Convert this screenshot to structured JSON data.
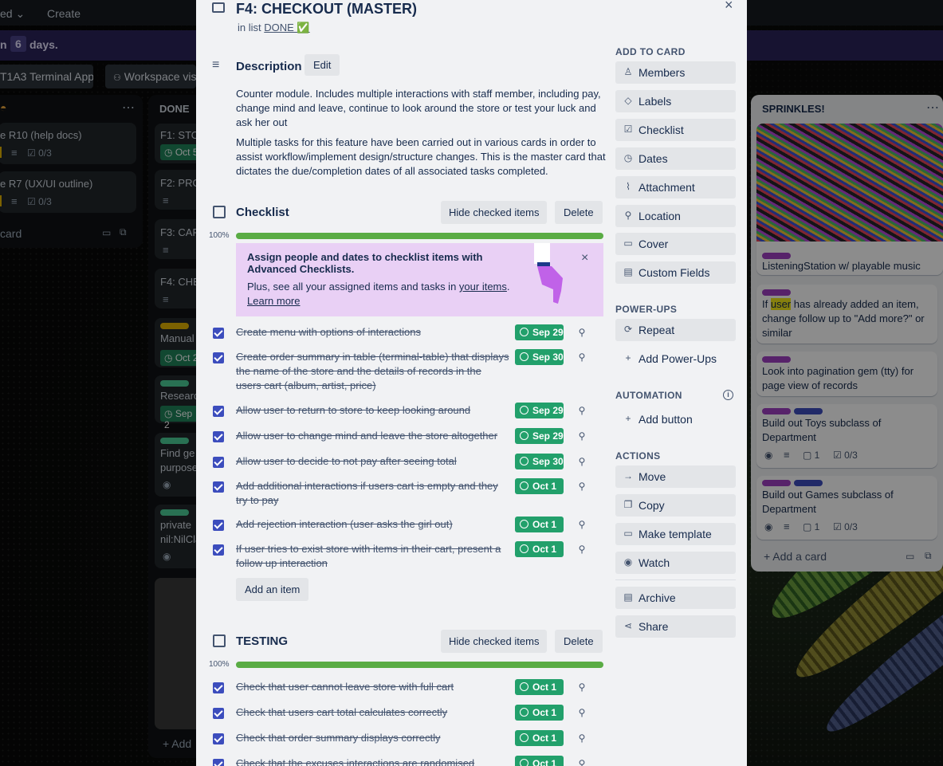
{
  "topbar": {
    "left_fragment": "ed",
    "create": "Create"
  },
  "banner": {
    "pre": "n",
    "days_num": "6",
    "post": "days."
  },
  "boardbar": {
    "board_name": "T1A3 Terminal App",
    "workspace": "Workspace vis"
  },
  "list_left": {
    "cards": [
      {
        "title": "e R10 (help docs)",
        "checklist": "0/3"
      },
      {
        "title": "e R7 (UX/UI outline)",
        "checklist": "0/3"
      }
    ],
    "add": "card"
  },
  "list_done": {
    "title": "DONE",
    "cards": [
      "F1: STO",
      "F2: PRO",
      "F3: CAR",
      "F4: CHE",
      "Manual",
      "Researc",
      "Find ge",
      "private"
    ],
    "card_extra": [
      "purpose",
      "nil:NilCla"
    ],
    "dates": [
      "Oct 5",
      "Oct 2",
      "Sep 2"
    ],
    "add": "Add"
  },
  "list_sprinkles": {
    "title": "SPRINKLES!",
    "cards": [
      {
        "title": "ListeningStation w/ playable music"
      },
      {
        "title_pre": "If ",
        "highlight": "user",
        "title_post": " has already added an item, change follow up to \"Add more?\" or similar"
      },
      {
        "title": "Look into pagination gem (tty) for page view of records"
      },
      {
        "title": "Build out Toys subclass of Department",
        "comments": "1",
        "checklist": "0/3"
      },
      {
        "title": "Build out Games subclass of Department",
        "comments": "1",
        "checklist": "0/3"
      }
    ],
    "add": "Add a card"
  },
  "card": {
    "title": "F4: CHECKOUT (MASTER)",
    "in_list_prefix": "in list",
    "list_name": "DONE ✅",
    "description_heading": "Description",
    "edit": "Edit",
    "description_p1": "Counter module. Includes multiple interactions with staff member, including pay, change mind and leave, continue to look around the store or test your luck and ask her out",
    "description_p2": "Multiple tasks for this feature have been carried out in various cards in order to assist workflow/implement design/structure changes. This is the master card that dictates the due/completion dates of all associated tasks completed.",
    "checklists": [
      {
        "title": "Checklist",
        "hide": "Hide checked items",
        "delete": "Delete",
        "percent": "100%",
        "progress": 1.0,
        "items": [
          {
            "text": "Create menu with options of interactions",
            "due": "Sep 29"
          },
          {
            "text": "Create order summary in table (terminal-table) that displays the name of the store and the details of records in the users cart (album, artist, price)",
            "due": "Sep 30"
          },
          {
            "text": "Allow user to return to store to keep looking around",
            "due": "Sep 29"
          },
          {
            "text": "Allow user to change mind and leave the store altogether",
            "due": "Sep 29"
          },
          {
            "text": "Allow user to decide to not pay after seeing total",
            "due": "Sep 30"
          },
          {
            "text": "Add additional interactions if users cart is empty and they try to pay",
            "due": "Oct 1"
          },
          {
            "text": "Add rejection interaction (user asks the girl out)",
            "due": "Oct 1"
          },
          {
            "text": "If user tries to exist store with items in their cart, present a follow up interaction",
            "due": "Oct 1"
          }
        ],
        "add_item": "Add an item"
      },
      {
        "title": "TESTING",
        "hide": "Hide checked items",
        "delete": "Delete",
        "percent": "100%",
        "progress": 1.0,
        "items": [
          {
            "text": "Check that user cannot leave store with full cart",
            "due": "Oct 1"
          },
          {
            "text": "Check that users cart total calculates correctly",
            "due": "Oct 1"
          },
          {
            "text": "Check that order summary displays correctly",
            "due": "Oct 1"
          },
          {
            "text": "Check that the excuses interactions are randomised",
            "due": "Oct 1"
          }
        ]
      }
    ],
    "promo": {
      "title": "Assign people and dates to checklist items with Advanced Checklists.",
      "body_pre": "Plus, see all your assigned items and tasks in ",
      "body_link": "your items",
      "body_post": ".",
      "learn": "Learn more"
    }
  },
  "sidebar": {
    "add_heading": "ADD TO CARD",
    "add": [
      "Members",
      "Labels",
      "Checklist",
      "Dates",
      "Attachment",
      "Location",
      "Cover",
      "Custom Fields"
    ],
    "powerups_heading": "POWER-UPS",
    "powerups": [
      "Repeat",
      "Add Power-Ups"
    ],
    "automation_heading": "AUTOMATION",
    "automation": [
      "Add button"
    ],
    "actions_heading": "ACTIONS",
    "actions": [
      "Move",
      "Copy",
      "Make template",
      "Watch",
      "Archive",
      "Share"
    ]
  },
  "colors": {
    "accent": "#3c4dbd",
    "due_green": "#22a06b",
    "progress": "#5aac44",
    "promo_bg": "#e9d0f5",
    "label_purple": "#9f3ec1",
    "label_blue": "#3c4dbd",
    "label_green": "#4bce97",
    "label_yellow": "#e2b203"
  }
}
